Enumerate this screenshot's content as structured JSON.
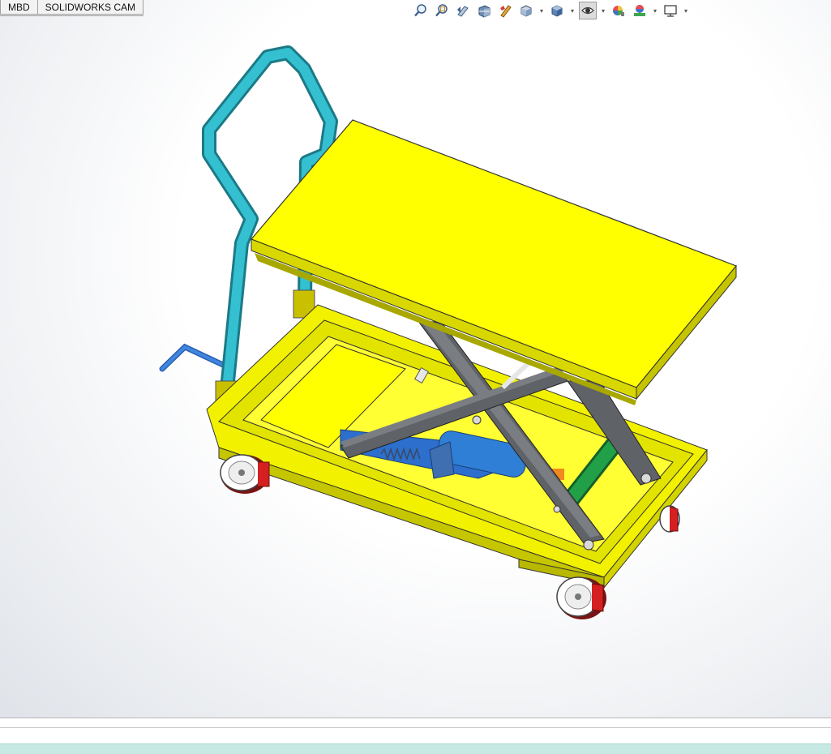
{
  "tabs": [
    {
      "label": "MBD"
    },
    {
      "label": "SOLIDWORKS CAM"
    }
  ],
  "toolbar": {
    "icons": [
      "zoom-to-fit-icon",
      "zoom-to-area-icon",
      "previous-view-icon",
      "section-view-icon",
      "dynamic-annotation-icon",
      "view-orientation-icon",
      "display-style-icon",
      "hide-show-items-icon",
      "edit-appearance-icon",
      "apply-scene-icon",
      "view-settings-icon"
    ]
  },
  "model": {
    "name": "hydraulic-scissor-lift-table-cart",
    "colors": {
      "platform": "#ffff00",
      "handle": "#2eb5c6",
      "scissor_arms": "#6b6e73",
      "cylinder": "#2f7fd6",
      "pump_handle": "#1e8a3a",
      "wheel_rim": "#d42020",
      "tow_handle": "#3a78d0"
    }
  }
}
